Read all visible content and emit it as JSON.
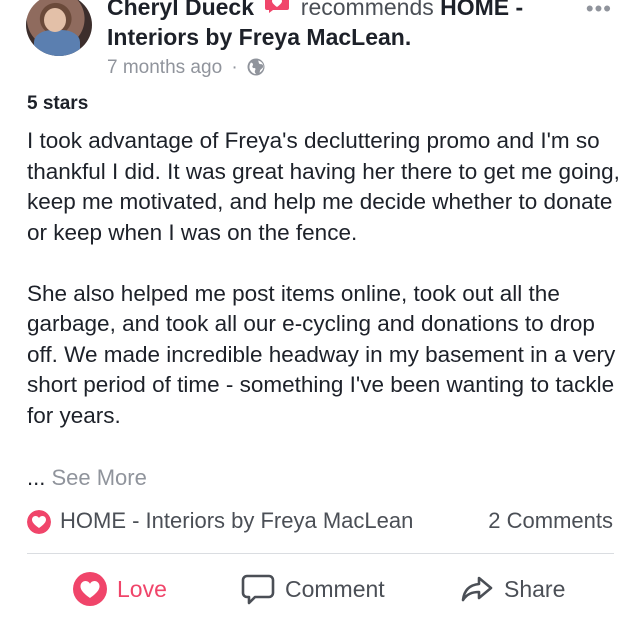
{
  "post": {
    "author": "Cheryl Dueck",
    "recommends_text": "recommends",
    "page_name_line1": "HOME -",
    "page_name_line2": "Interiors by Freya MacLean.",
    "timestamp": "7 months ago",
    "meta_separator": "·",
    "more_label": "•••"
  },
  "review": {
    "rating_label": "5 stars",
    "paragraphs": [
      "I took advantage of Freya's decluttering promo and I'm so thankful I did. It was great having her there to get me going, keep me motivated, and help me decide whether to donate or keep when I was on the fence.",
      "She also helped me post items online, took out all the garbage, and took all our e-cycling and donations to drop off. We made incredible headway in my basement in a very short period of time - something I've been wanting to tackle for years."
    ],
    "ellipsis": "...",
    "see_more": "See More"
  },
  "summary": {
    "page_link": "HOME - Interiors by Freya MacLean",
    "comments": "2 Comments"
  },
  "actions": {
    "love": "Love",
    "comment": "Comment",
    "share": "Share"
  },
  "colors": {
    "love": "#f0456a",
    "muted": "#90949c",
    "text": "#1d2129"
  },
  "icons": [
    "heart-badge-icon",
    "globe-icon",
    "more-icon",
    "love-icon",
    "comment-icon",
    "share-icon"
  ]
}
